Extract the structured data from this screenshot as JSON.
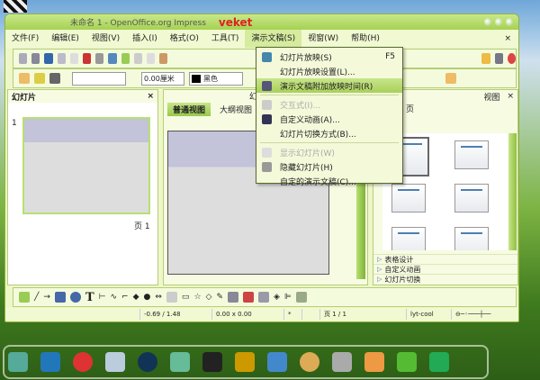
{
  "window": {
    "title": "未命名 1 - OpenOffice.org Impress",
    "badge": "veket"
  },
  "menubar": [
    "文件(F)",
    "编辑(E)",
    "视图(V)",
    "插入(I)",
    "格式(O)",
    "工具(T)",
    "演示文稿(S)",
    "视窗(W)",
    "帮助(H)"
  ],
  "menubar_close": "×",
  "toolbar2": {
    "line_width": "0.00厘米",
    "color": "黑色"
  },
  "slides_panel": {
    "title": "幻灯片",
    "close": "×",
    "slide_number": "1",
    "page_label": "页 1"
  },
  "center": {
    "tab_header": "幻灯",
    "tabs": [
      "普通视图",
      "大纲视图"
    ]
  },
  "dropdown": {
    "items": [
      {
        "label": "幻灯片放映(S)",
        "shortcut": "F5",
        "disabled": false
      },
      {
        "label": "幻灯片放映设置(L)...",
        "disabled": false
      },
      {
        "label": "演示文稿附加放映时间(R)",
        "disabled": false,
        "highlighted": true
      },
      {
        "label": "交互式(I)...",
        "disabled": true
      },
      {
        "label": "自定义动画(A)...",
        "disabled": false
      },
      {
        "label": "幻灯片切换方式(B)...",
        "disabled": false
      },
      {
        "label": "显示幻灯片(W)",
        "disabled": true
      },
      {
        "label": "隐藏幻灯片(H)",
        "disabled": false
      },
      {
        "label": "自定的演示文稿(C)...",
        "disabled": false
      }
    ]
  },
  "task_pane": {
    "view_label": "视图",
    "close": "×",
    "section": "页",
    "panels": [
      "表格设计",
      "自定义动画",
      "幻灯片切换"
    ]
  },
  "status": {
    "position": "-0.69 / 1.48",
    "size": "0.00 x 0.00",
    "modified": "*",
    "page": "页 1 / 1",
    "layout": "lyt-cool"
  },
  "colors": {
    "accent": "#a6d152",
    "highlight": "#c8e58a"
  }
}
